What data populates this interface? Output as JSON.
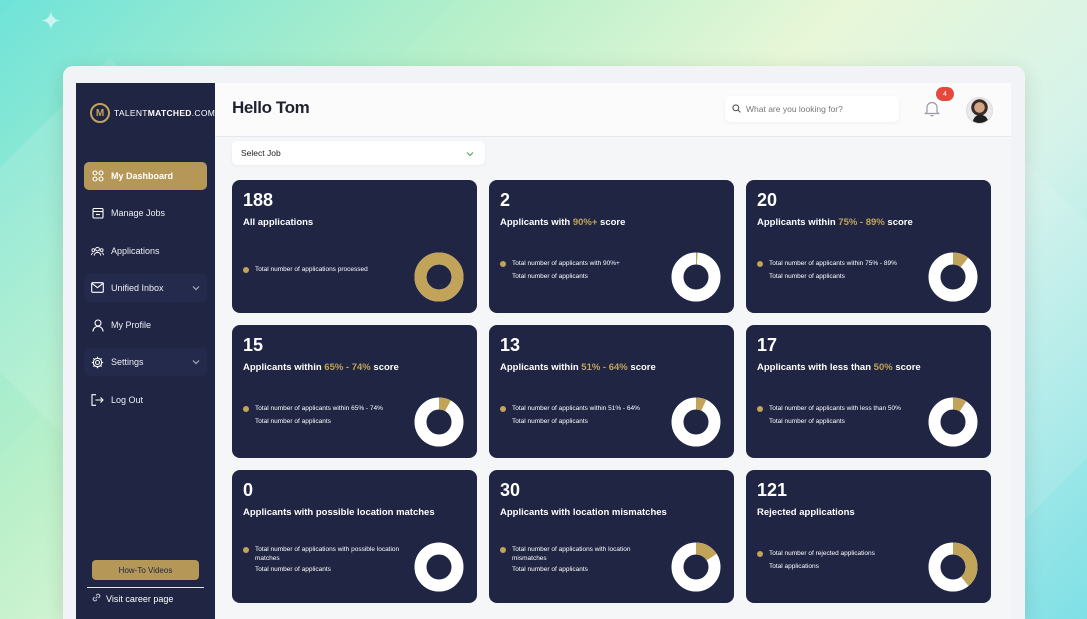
{
  "brand": {
    "logo_mark": "M",
    "logo_text_light": "TALENT",
    "logo_text_bold": "MATCHED",
    "logo_text_tail": ".COM"
  },
  "sidebar": {
    "items": [
      {
        "label": "My Dashboard",
        "icon": "grid-icon",
        "active": true
      },
      {
        "label": "Manage Jobs",
        "icon": "calendar-icon"
      },
      {
        "label": "Applications",
        "icon": "people-icon"
      },
      {
        "label": "Unified Inbox",
        "icon": "mail-icon",
        "has_children": true
      },
      {
        "label": "My Profile",
        "icon": "user-icon"
      },
      {
        "label": "Settings",
        "icon": "gear-icon",
        "has_children": true
      },
      {
        "label": "Log Out",
        "icon": "logout-icon"
      }
    ],
    "howto_label": "How-To Videos",
    "career_label": "Visit career page"
  },
  "header": {
    "greeting": "Hello Tom",
    "search_placeholder": "What are you looking for?",
    "notification_count": "4"
  },
  "select_job": {
    "value": "Select Job"
  },
  "colors": {
    "navy": "#1f2543",
    "gold": "#c2a35a",
    "white": "#ffffff",
    "badge": "#e5493e"
  },
  "cards": [
    {
      "count": "188",
      "title_pre": "All applications",
      "title_hl": "",
      "title_post": "",
      "legend1": "Total number of applications processed",
      "legend2": "",
      "fraction": 1.0
    },
    {
      "count": "2",
      "title_pre": "Applicants with ",
      "title_hl": "90%+",
      "title_post": " score",
      "legend1": "Total number of applicants with 90%+",
      "legend2": "Total number of applicants",
      "fraction": 0.011
    },
    {
      "count": "20",
      "title_pre": "Applicants within ",
      "title_hl": "75% - 89%",
      "title_post": " score",
      "legend1": "Total number of applicants within 75% - 89%",
      "legend2": "Total number of applicants",
      "fraction": 0.106
    },
    {
      "count": "15",
      "title_pre": "Applicants within ",
      "title_hl": "65% - 74%",
      "title_post": " score",
      "legend1": "Total number of applicants within 65% - 74%",
      "legend2": "Total number of applicants",
      "fraction": 0.08
    },
    {
      "count": "13",
      "title_pre": "Applicants within ",
      "title_hl": "51% - 64%",
      "title_post": " score",
      "legend1": "Total number of applicants within 51% - 64%",
      "legend2": "Total number of applicants",
      "fraction": 0.069
    },
    {
      "count": "17",
      "title_pre": "Applicants with less than ",
      "title_hl": "50%",
      "title_post": " score",
      "legend1": "Total number of applicants with less than 50%",
      "legend2": "Total number of applicants",
      "fraction": 0.09
    },
    {
      "count": "0",
      "title_pre": "Applicants with possible location matches",
      "title_hl": "",
      "title_post": "",
      "legend1": "Total number of applications with possible location",
      "legend1b": "matches",
      "legend2": "Total number of applicants",
      "fraction": 0.0
    },
    {
      "count": "30",
      "title_pre": "Applicants with location mismatches",
      "title_hl": "",
      "title_post": "",
      "legend1": "Total number of applications with location",
      "legend1b": "mismatches",
      "legend2": "Total number of applicants",
      "fraction": 0.16
    },
    {
      "count": "121",
      "title_pre": "Rejected applications",
      "title_hl": "",
      "title_post": "",
      "legend1": "Total number of rejected applications",
      "legend2": "Total applications",
      "fraction": 0.39
    }
  ]
}
